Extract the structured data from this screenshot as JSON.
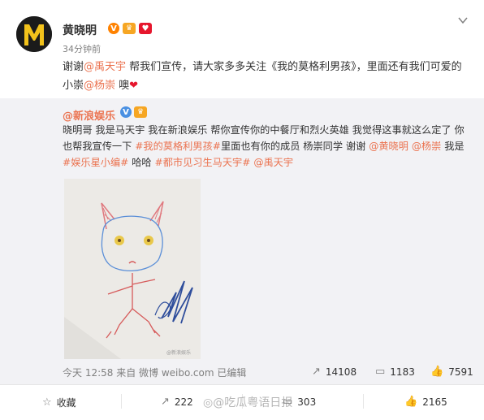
{
  "author": {
    "name": "黄晓明",
    "time": "34分钟前"
  },
  "post": {
    "pre": "谢谢",
    "mention1": "@禹天宇",
    "mid": " 帮我们宣传，请大家多多关注《我的莫格利男孩》，里面还有我们可爱的小崇",
    "mention2": "@杨崇",
    "end": " 噢"
  },
  "repost": {
    "name": "@新浪娱乐",
    "text1": "晓明哥 我是马天宇 我在新浪娱乐 帮你宣传你的中餐厅和烈火英雄 我觉得这事就这么定了 你也帮我宣传一下 ",
    "tag1": "#我的莫格利男孩#",
    "text2": "里面也有你的成员 杨崇同学 谢谢 ",
    "mention1": "@黄晓明",
    "mention2": "@杨崇",
    "text3": " 我是",
    "tag2": "#娱乐星小编#",
    "text4": "  哈哈 ",
    "tag3": "#都市见习生马天宇#",
    "mention3": "@禹天宇",
    "meta": "今天 12:58 来自 微博 weibo.com  已编辑",
    "share_count": "14108",
    "comment_count": "1183",
    "like_count": "7591",
    "image_watermark": "@新浪娱乐"
  },
  "actions": {
    "favorite": "收藏",
    "share": "222",
    "comment": "303",
    "like": "2165"
  },
  "watermark": "@吃瓜粤语日报",
  "colors": {
    "link": "#eb7350",
    "heart": "#e6162d",
    "vip": "#ff8200"
  }
}
